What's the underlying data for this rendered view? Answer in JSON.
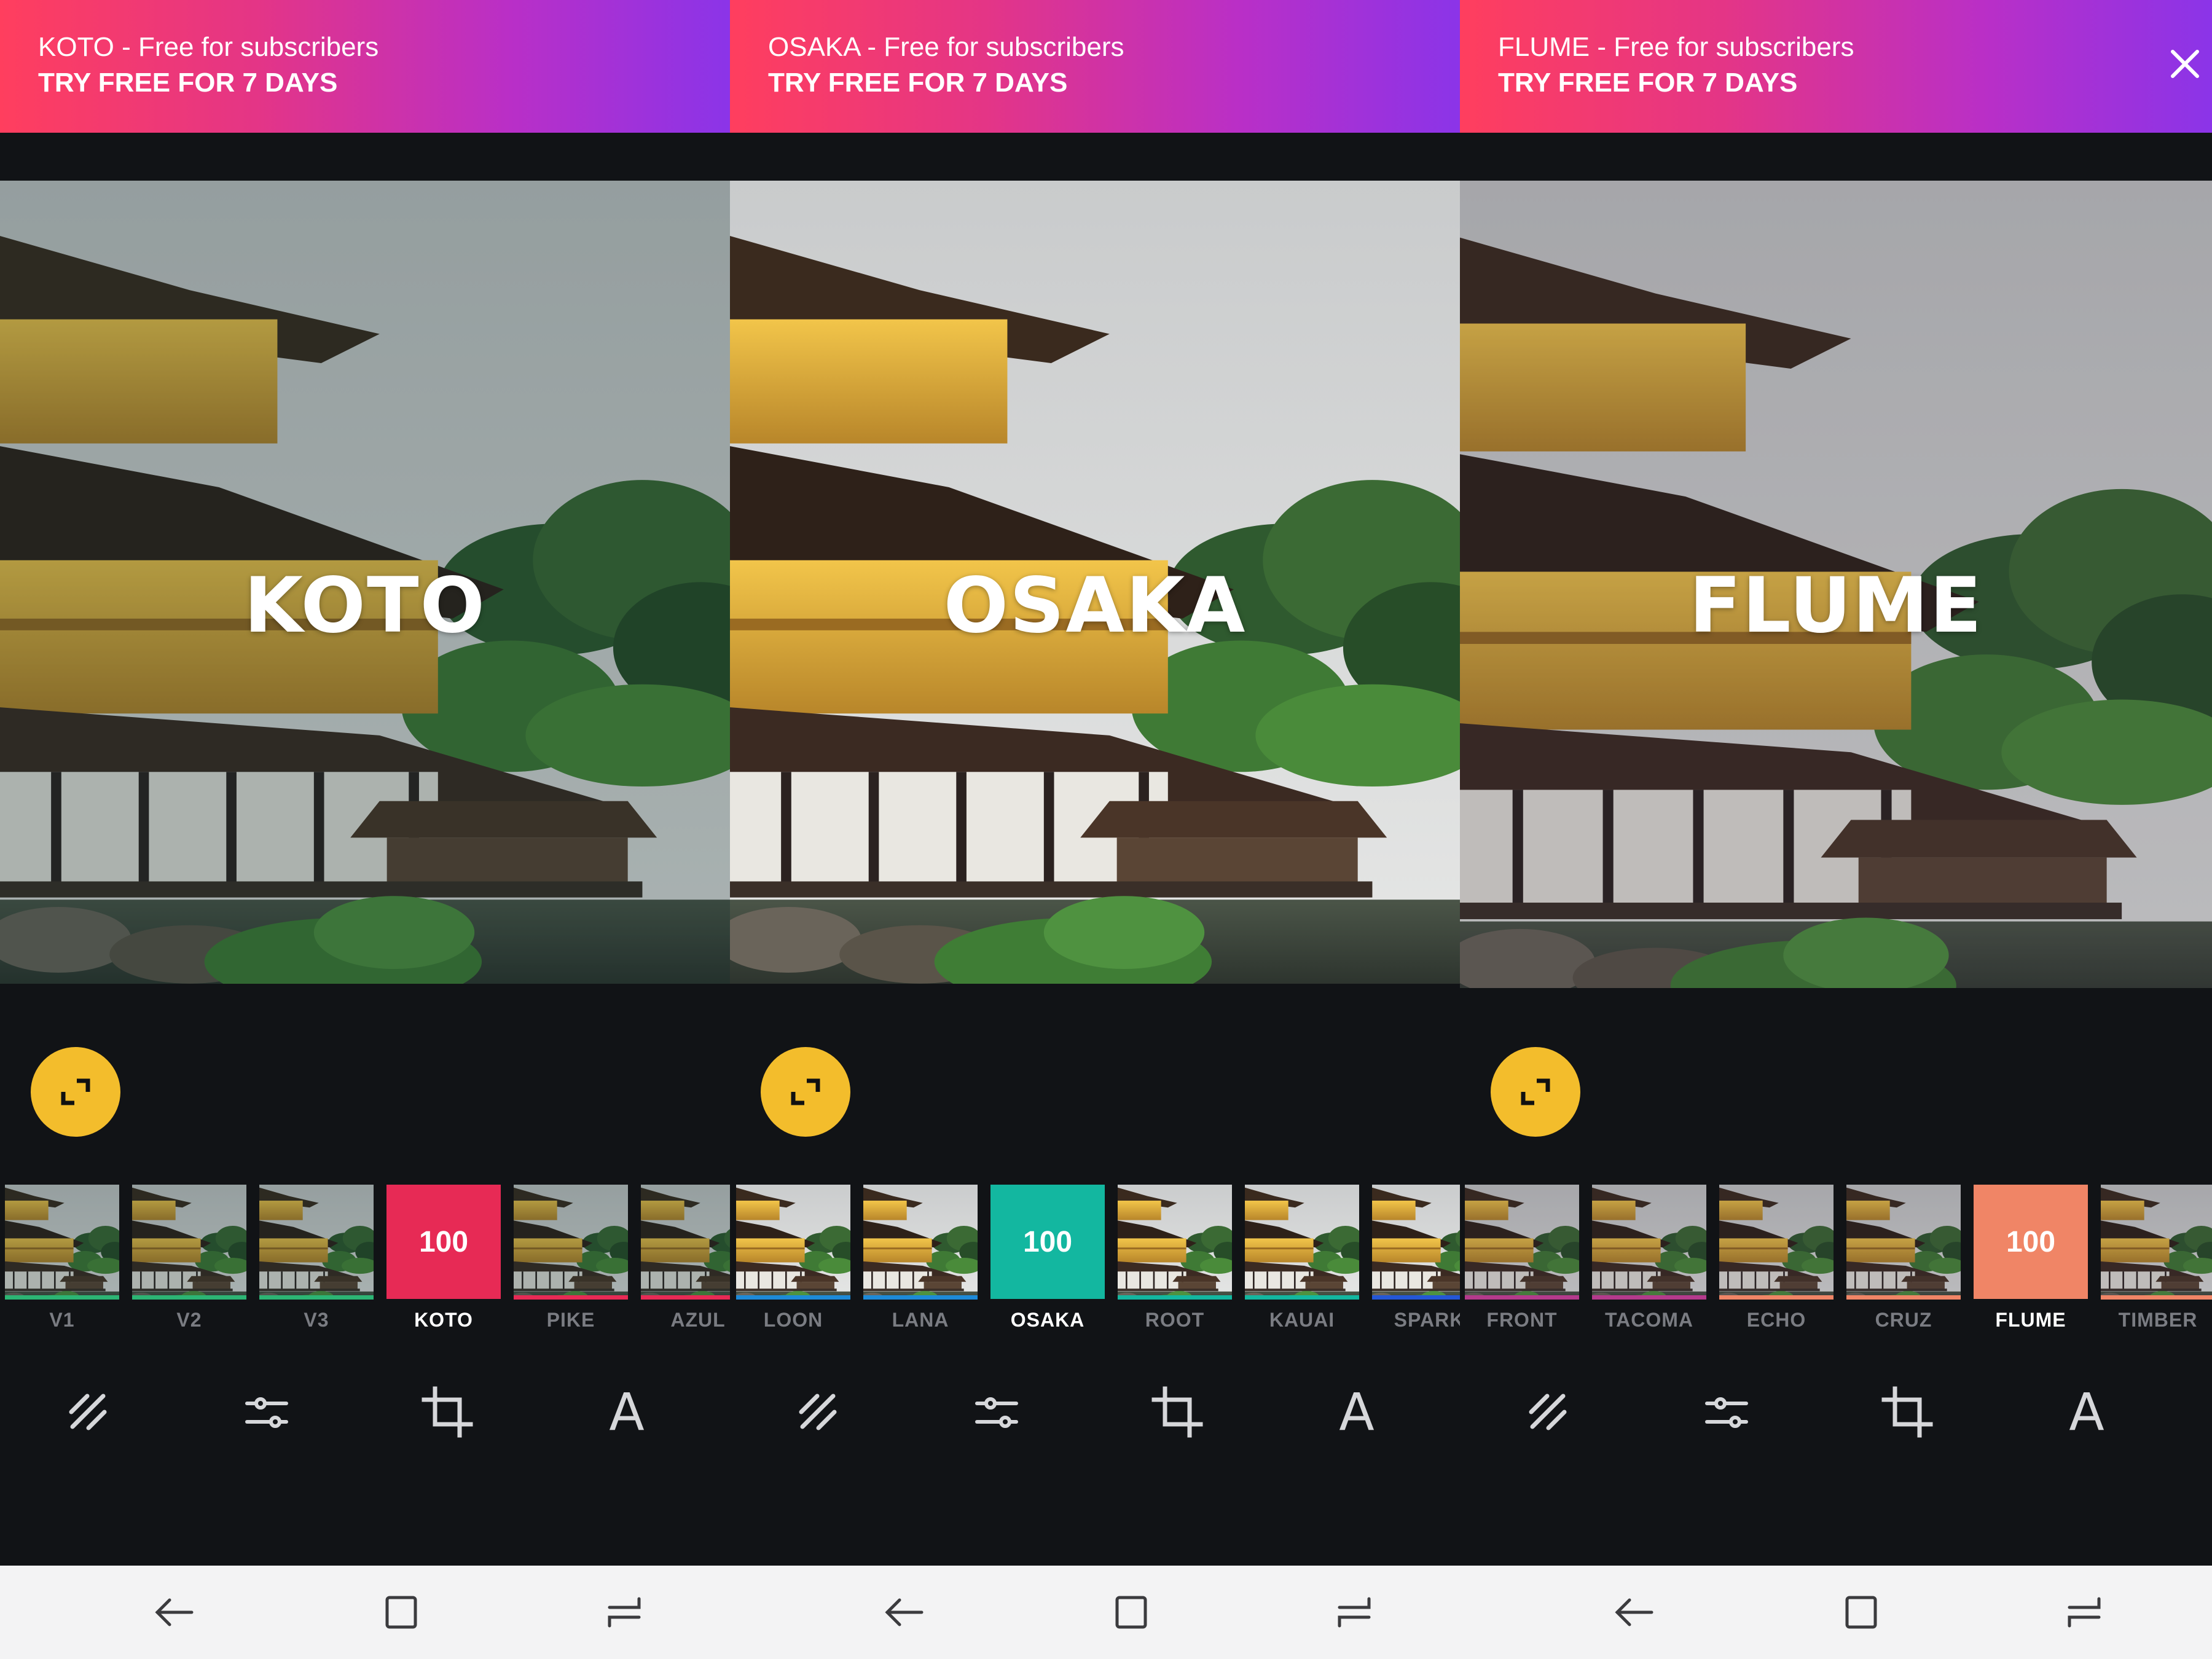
{
  "panels": [
    {
      "banner": {
        "line1": "KOTO - Free for subscribers",
        "line2": "TRY FREE FOR 7 DAYS"
      },
      "overlay": "KOTO",
      "filters": [
        {
          "label": "V1",
          "bar": "#2cb574",
          "selected": false
        },
        {
          "label": "V2",
          "bar": "#2cb574",
          "selected": false
        },
        {
          "label": "V3",
          "bar": "#2cb574",
          "selected": false
        },
        {
          "label": "KOTO",
          "bar": "#e72a55",
          "selected": true,
          "value": "100"
        },
        {
          "label": "PIKE",
          "bar": "#e72a55",
          "selected": false
        },
        {
          "label": "AZUL",
          "bar": "#e72a55",
          "selected": false
        }
      ],
      "tint": "#0e2a2a",
      "tint_opacity": 0.28
    },
    {
      "banner": {
        "line1": "OSAKA - Free for subscribers",
        "line2": "TRY FREE FOR 7 DAYS"
      },
      "overlay": "OSAKA",
      "filters": [
        {
          "label": "LOON",
          "bar": "#1d8ad8",
          "selected": false
        },
        {
          "label": "LANA",
          "bar": "#1d8ad8",
          "selected": false
        },
        {
          "label": "OSAKA",
          "bar": "#13b7a0",
          "selected": true,
          "value": "100"
        },
        {
          "label": "ROOT",
          "bar": "#13b7a0",
          "selected": false
        },
        {
          "label": "KAUAI",
          "bar": "#13b7a0",
          "selected": false
        },
        {
          "label": "SPARK",
          "bar": "#2457d6",
          "selected": false
        }
      ],
      "tint": "#ffffff",
      "tint_opacity": 0.0
    },
    {
      "banner": {
        "line1": "FLUME - Free for subscribers",
        "line2": "TRY FREE FOR 7 DAYS"
      },
      "overlay": "FLUME",
      "filters": [
        {
          "label": "FRONT",
          "bar": "#b43a8c",
          "selected": false
        },
        {
          "label": "TACOMA",
          "bar": "#b43a8c",
          "selected": false
        },
        {
          "label": "ECHO",
          "bar": "#f08566",
          "selected": false
        },
        {
          "label": "CRUZ",
          "bar": "#f08566",
          "selected": false
        },
        {
          "label": "FLUME",
          "bar": "#f08566",
          "selected": true,
          "value": "100"
        },
        {
          "label": "TIMBER",
          "bar": "#f08566",
          "selected": false
        }
      ],
      "tint": "#2a2430",
      "tint_opacity": 0.22
    }
  ],
  "toolbar": {
    "icons": [
      "presets-icon",
      "adjust-sliders-icon",
      "crop-icon",
      "text-tool-icon"
    ],
    "text_glyph": "A"
  },
  "colors": {
    "fullscreen_button": "#f3bd2c",
    "banner_gradient": [
      "#ff3e5e",
      "#8b34e8"
    ]
  }
}
